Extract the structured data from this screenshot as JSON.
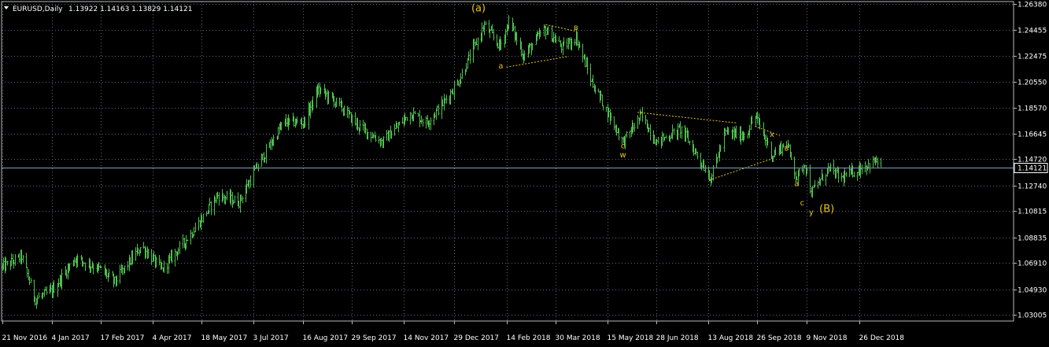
{
  "window": {
    "symbol": "EURUSD,Daily",
    "ohlc": "1.13922 1.14163 1.13829 1.14121",
    "current_price": "1.14121"
  },
  "colors": {
    "background": "#000000",
    "grid": "#5a6b78",
    "bar_up": "#4fc04f",
    "bar_down": "#4fc04f",
    "wave_label": "#e6c619",
    "trendline": "#e6c619",
    "price_line": "#7f9fbf",
    "axis_text": "#ffffff"
  },
  "chart_data": {
    "type": "ohlc",
    "title": "EURUSD,Daily",
    "y_ticks": [
      "1.26380",
      "1.24455",
      "1.22475",
      "1.20550",
      "1.18570",
      "1.16645",
      "1.14720",
      "1.12740",
      "1.10815",
      "1.08835",
      "1.06910",
      "1.04930",
      "1.03005"
    ],
    "ylim": [
      1.0255,
      1.2658
    ],
    "x_ticks": [
      "21 Nov 2016",
      "4 Jan 2017",
      "17 Feb 2017",
      "4 Apr 2017",
      "18 May 2017",
      "3 Jul 2017",
      "16 Aug 2017",
      "29 Sep 2017",
      "14 Nov 2017",
      "29 Dec 2017",
      "14 Feb 2018",
      "30 Mar 2018",
      "15 May 2018",
      "28 Jun 2018",
      "13 Aug 2018",
      "26 Sep 2018",
      "9 Nov 2018",
      "26 Dec 2018"
    ],
    "grid": true,
    "price_path": [
      {
        "date": "2016-11-21",
        "price": 1.066
      },
      {
        "date": "2016-12-08",
        "price": 1.074
      },
      {
        "date": "2016-12-20",
        "price": 1.042
      },
      {
        "date": "2017-01-04",
        "price": 1.048
      },
      {
        "date": "2017-01-25",
        "price": 1.073
      },
      {
        "date": "2017-02-17",
        "price": 1.064
      },
      {
        "date": "2017-03-01",
        "price": 1.055
      },
      {
        "date": "2017-03-25",
        "price": 1.082
      },
      {
        "date": "2017-04-12",
        "price": 1.064
      },
      {
        "date": "2017-05-10",
        "price": 1.093
      },
      {
        "date": "2017-06-01",
        "price": 1.12
      },
      {
        "date": "2017-06-20",
        "price": 1.115
      },
      {
        "date": "2017-07-05",
        "price": 1.14
      },
      {
        "date": "2017-07-30",
        "price": 1.175
      },
      {
        "date": "2017-08-17",
        "price": 1.175
      },
      {
        "date": "2017-08-30",
        "price": 1.2
      },
      {
        "date": "2017-09-15",
        "price": 1.19
      },
      {
        "date": "2017-10-05",
        "price": 1.172
      },
      {
        "date": "2017-10-26",
        "price": 1.16
      },
      {
        "date": "2017-11-20",
        "price": 1.182
      },
      {
        "date": "2017-12-05",
        "price": 1.175
      },
      {
        "date": "2017-12-20",
        "price": 1.19
      },
      {
        "date": "2018-01-02",
        "price": 1.206
      },
      {
        "date": "2018-01-25",
        "price": 1.248
      },
      {
        "date": "2018-02-08",
        "price": 1.232
      },
      {
        "date": "2018-02-16",
        "price": 1.251
      },
      {
        "date": "2018-03-01",
        "price": 1.225
      },
      {
        "date": "2018-03-20",
        "price": 1.245
      },
      {
        "date": "2018-04-05",
        "price": 1.231
      },
      {
        "date": "2018-04-17",
        "price": 1.239
      },
      {
        "date": "2018-05-01",
        "price": 1.205
      },
      {
        "date": "2018-05-29",
        "price": 1.16
      },
      {
        "date": "2018-06-14",
        "price": 1.18
      },
      {
        "date": "2018-06-28",
        "price": 1.16
      },
      {
        "date": "2018-07-20",
        "price": 1.17
      },
      {
        "date": "2018-08-15",
        "price": 1.133
      },
      {
        "date": "2018-08-28",
        "price": 1.167
      },
      {
        "date": "2018-09-15",
        "price": 1.165
      },
      {
        "date": "2018-09-24",
        "price": 1.18
      },
      {
        "date": "2018-10-09",
        "price": 1.15
      },
      {
        "date": "2018-10-22",
        "price": 1.16
      },
      {
        "date": "2018-10-31",
        "price": 1.133
      },
      {
        "date": "2018-11-07",
        "price": 1.145
      },
      {
        "date": "2018-11-13",
        "price": 1.122
      },
      {
        "date": "2018-11-28",
        "price": 1.14
      },
      {
        "date": "2018-12-10",
        "price": 1.133
      },
      {
        "date": "2018-12-26",
        "price": 1.14
      },
      {
        "date": "2019-01-10",
        "price": 1.146
      },
      {
        "date": "2019-01-14",
        "price": 1.141
      }
    ],
    "wave_labels": [
      {
        "text": "(a)",
        "date": "2018-01-20",
        "price": 1.2585,
        "size": "big"
      },
      {
        "text": "a",
        "date": "2018-02-09",
        "price": 1.2155,
        "size": "sm"
      },
      {
        "text": "в",
        "date": "2018-04-17",
        "price": 1.2445,
        "size": "sm"
      },
      {
        "text": "c",
        "date": "2018-05-29",
        "price": 1.1555,
        "size": "sm"
      },
      {
        "text": "w",
        "date": "2018-05-29",
        "price": 1.1485,
        "size": "sm"
      },
      {
        "text": "x",
        "date": "2018-10-09",
        "price": 1.164,
        "size": "sm"
      },
      {
        "text": "в",
        "date": "2018-10-22",
        "price": 1.1535,
        "size": "sm"
      },
      {
        "text": "a",
        "date": "2018-10-31",
        "price": 1.127,
        "size": "sm"
      },
      {
        "text": "c",
        "date": "2018-11-05",
        "price": 1.1125,
        "size": "sm"
      },
      {
        "text": "y",
        "date": "2018-11-13",
        "price": 1.1055,
        "size": "sm"
      },
      {
        "text": "(B)",
        "date": "2018-11-27",
        "price": 1.1075,
        "size": "big"
      }
    ],
    "trendlines": [
      {
        "from": {
          "date": "2018-02-14",
          "price": 1.2165
        },
        "to": {
          "date": "2018-04-10",
          "price": 1.2245
        }
      },
      {
        "from": {
          "date": "2018-03-21",
          "price": 1.2485
        },
        "to": {
          "date": "2018-04-17",
          "price": 1.2435
        }
      },
      {
        "from": {
          "date": "2018-06-11",
          "price": 1.1825
        },
        "to": {
          "date": "2018-09-07",
          "price": 1.1745
        }
      },
      {
        "from": {
          "date": "2018-08-14",
          "price": 1.1315
        },
        "to": {
          "date": "2018-10-09",
          "price": 1.1475
        }
      },
      {
        "from": {
          "date": "2018-09-24",
          "price": 1.172
        },
        "to": {
          "date": "2018-10-16",
          "price": 1.165
        }
      }
    ]
  }
}
